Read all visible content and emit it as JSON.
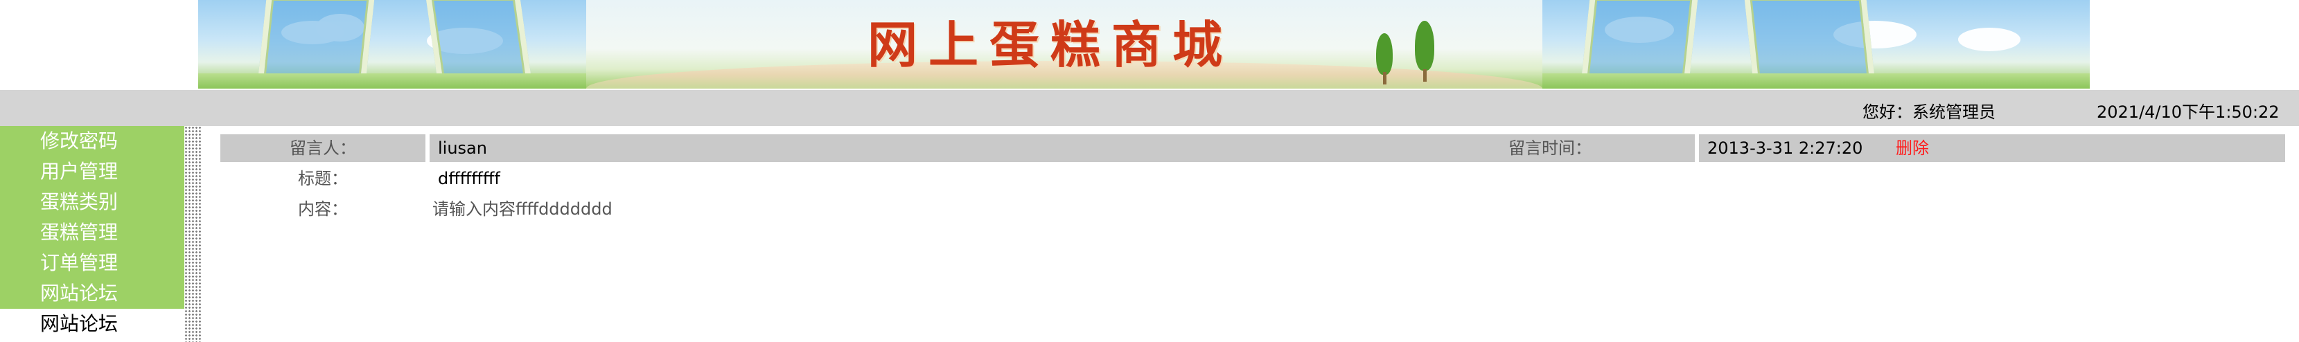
{
  "banner": {
    "title": "网上蛋糕商城"
  },
  "header": {
    "greeting": "您好：系统管理员",
    "datetime": "2021/4/10下午1:50:22"
  },
  "sidebar": {
    "items": [
      {
        "label": "修改密码"
      },
      {
        "label": "用户管理"
      },
      {
        "label": "蛋糕类别"
      },
      {
        "label": "蛋糕管理"
      },
      {
        "label": "订单管理"
      },
      {
        "label": "网站论坛"
      },
      {
        "label": "网站论坛"
      }
    ]
  },
  "message": {
    "author_label": "留言人：",
    "author": "liusan",
    "time_label": "留言时间：",
    "time": "2013-3-31 2:27:20",
    "delete_label": "删除",
    "title_label": "标题：",
    "title": "dfffffffff",
    "content_label": "内容：",
    "content": "请输入内容ffffddddddd"
  },
  "colors": {
    "menu_bg": "#9dd165",
    "header_bar": "#d4d4d4",
    "label_bg": "#c9c9c9",
    "delete": "#ff1a1a",
    "banner_title": "#cf3a18"
  }
}
